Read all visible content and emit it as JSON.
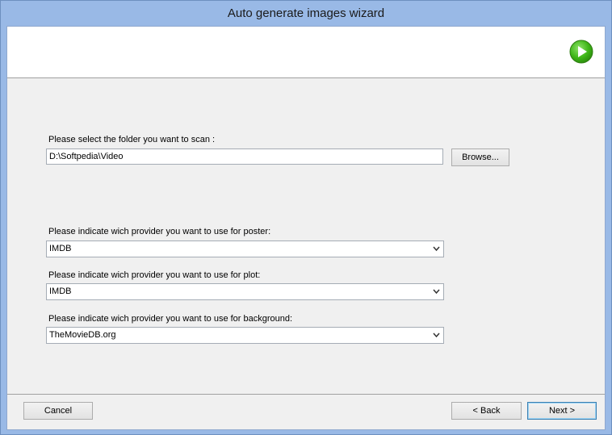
{
  "window": {
    "title": "Auto generate images wizard"
  },
  "header": {
    "next_icon": "green-arrow-right-icon"
  },
  "folder": {
    "label": "Please select the folder you want to scan :",
    "value": "D:\\Softpedia\\Video",
    "browse_label": "Browse..."
  },
  "poster": {
    "label": "Please indicate wich provider you want to use for poster:",
    "selected": "IMDB"
  },
  "plot": {
    "label": "Please indicate wich provider you want to use for plot:",
    "selected": "IMDB"
  },
  "background": {
    "label": "Please indicate wich provider you want to use for background:",
    "selected": "TheMovieDB.org"
  },
  "footer": {
    "cancel_label": "Cancel",
    "back_label": "< Back",
    "next_label": "Next >"
  },
  "colors": {
    "frame": "#99b9e6",
    "client": "#f0f0f0",
    "accent_green": "#3fb618"
  }
}
